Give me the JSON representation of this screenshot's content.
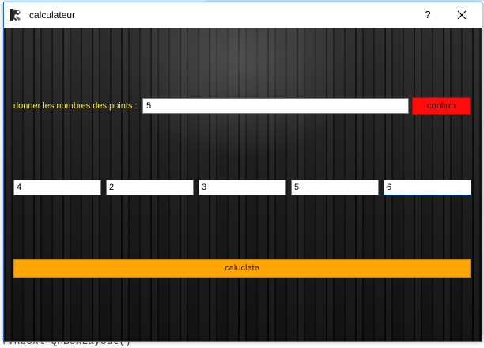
{
  "window": {
    "title": "calculateur",
    "help_label": "?"
  },
  "form": {
    "prompt_label": "donner les nombres des points :",
    "count_value": "5",
    "confirm_label": "confirm",
    "points": [
      "4",
      "2",
      "3",
      "5",
      "6"
    ],
    "calculate_label": "caluclate"
  },
  "background": {
    "bottom_code": "f.hboxl=QHBoxLayout()"
  },
  "icons": {
    "app": "python-app-icon",
    "close": "close-icon"
  },
  "colors": {
    "prompt_text": "#f0e640",
    "confirm_bg": "#ff0d0d",
    "calculate_bg": "#ffa500",
    "focus_border": "#1e78d4"
  }
}
